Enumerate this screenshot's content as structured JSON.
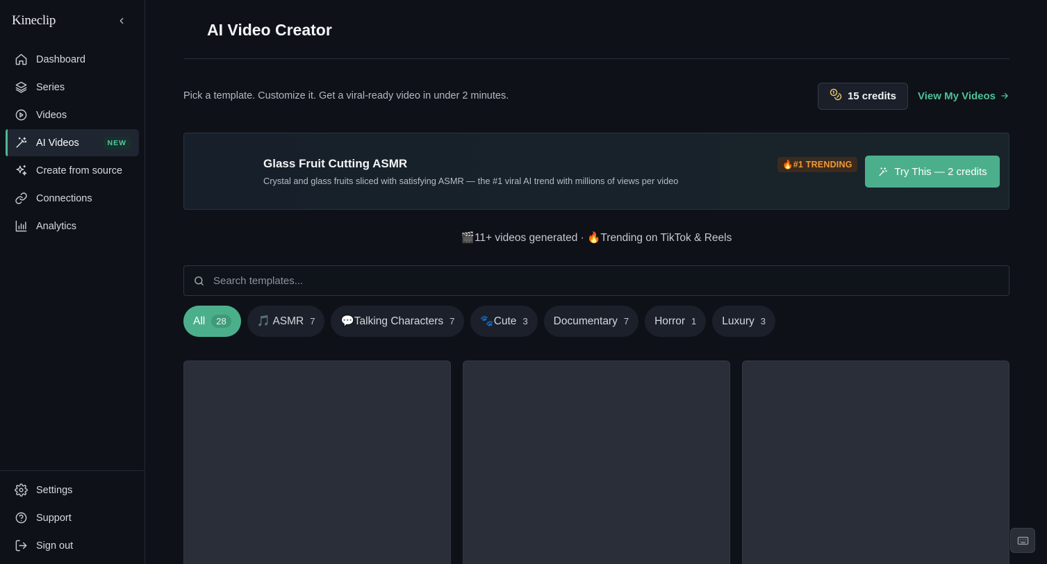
{
  "app": {
    "brand": "Kineclip"
  },
  "sidebar": {
    "collapse_icon": "chevron-left-icon",
    "items": [
      {
        "label": "Dashboard",
        "icon": "home-icon"
      },
      {
        "label": "Series",
        "icon": "layers-icon"
      },
      {
        "label": "Videos",
        "icon": "play-circle-icon"
      },
      {
        "label": "AI Videos",
        "icon": "magic-wand-icon",
        "badge": "NEW",
        "active": true
      },
      {
        "label": "Create from source",
        "icon": "sparkles-icon"
      },
      {
        "label": "Connections",
        "icon": "link-icon"
      },
      {
        "label": "Analytics",
        "icon": "bar-chart-icon"
      }
    ],
    "bottom_items": [
      {
        "label": "Settings",
        "icon": "gear-icon"
      },
      {
        "label": "Support",
        "icon": "help-circle-icon"
      },
      {
        "label": "Sign out",
        "icon": "logout-icon"
      }
    ]
  },
  "header": {
    "title": "AI Video Creator"
  },
  "subheader": {
    "subtitle": "Pick a template. Customize it. Get a viral-ready video in under 2 minutes.",
    "credits": "15 credits",
    "view_link": "View My Videos"
  },
  "featured": {
    "title": "Glass Fruit Cutting ASMR",
    "description": "Crystal and glass fruits sliced with satisfying ASMR — the #1 viral AI trend with millions of views per video",
    "badge": "🔥#1 TRENDING",
    "cta": "Try This — 2 credits"
  },
  "stats": "🎬11+ videos generated · 🔥Trending on TikTok & Reels",
  "search": {
    "placeholder": "Search templates..."
  },
  "filters": [
    {
      "label": "All",
      "count": "28",
      "active": true
    },
    {
      "label": "🎵 ASMR",
      "count": "7"
    },
    {
      "label": "💬Talking Characters",
      "count": "7"
    },
    {
      "label": "🐾Cute",
      "count": "3"
    },
    {
      "label": "Documentary",
      "count": "7"
    },
    {
      "label": "Horror",
      "count": "1"
    },
    {
      "label": "Luxury",
      "count": "3"
    }
  ],
  "colors": {
    "accent": "#4caf8c",
    "accent_text": "#4fc196",
    "trending": "#f29a3c",
    "background": "#0e1118"
  }
}
